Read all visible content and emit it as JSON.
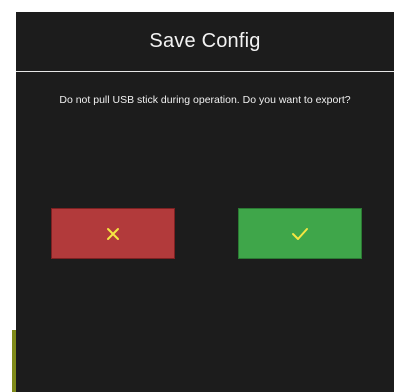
{
  "dialog": {
    "title": "Save Config",
    "message": "Do not pull USB stick during operation. Do you want to export?"
  },
  "buttons": {
    "cancel": {
      "icon": "close-icon",
      "glyph_color": "#f5e642"
    },
    "confirm": {
      "icon": "check-icon",
      "glyph_color": "#f5e642"
    }
  },
  "colors": {
    "background": "#1c1c1c",
    "cancel": "#b23a3b",
    "confirm": "#3fa64a",
    "accent": "#7f8a1a"
  }
}
